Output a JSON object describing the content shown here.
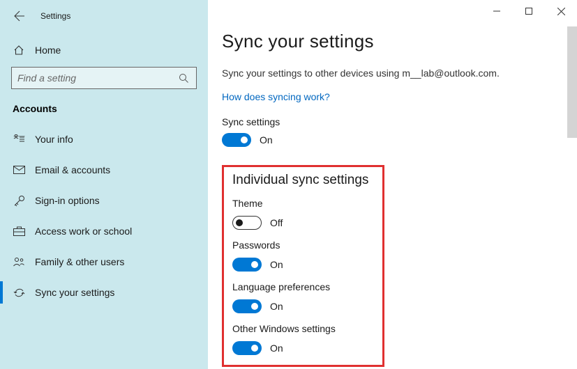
{
  "window": {
    "title": "Settings"
  },
  "sidebar": {
    "home_label": "Home",
    "search_placeholder": "Find a setting",
    "section_label": "Accounts",
    "items": [
      {
        "label": "Your info"
      },
      {
        "label": "Email & accounts"
      },
      {
        "label": "Sign-in options"
      },
      {
        "label": "Access work or school"
      },
      {
        "label": "Family & other users"
      },
      {
        "label": "Sync your settings"
      }
    ]
  },
  "main": {
    "title": "Sync your settings",
    "description": "Sync your settings to other devices using m__lab@outlook.com.",
    "help_link": "How does syncing work?",
    "sync_settings": {
      "label": "Sync settings",
      "state": "On"
    },
    "individual": {
      "heading": "Individual sync settings",
      "theme": {
        "label": "Theme",
        "state": "Off"
      },
      "passwords": {
        "label": "Passwords",
        "state": "On"
      },
      "language": {
        "label": "Language preferences",
        "state": "On"
      },
      "other": {
        "label": "Other Windows settings",
        "state": "On"
      }
    }
  }
}
